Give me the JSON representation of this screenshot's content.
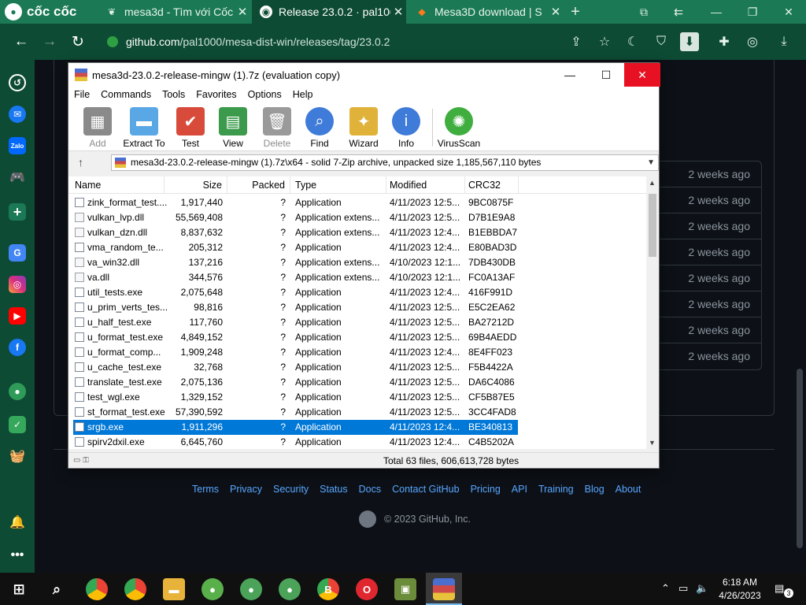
{
  "browser": {
    "brand": "cốc cốc",
    "tabs": [
      {
        "label": "mesa3d - Tìm với Cốc",
        "icon": "leaf-icon"
      },
      {
        "label": "Release 23.0.2 · pal100",
        "icon": "github-icon"
      },
      {
        "label": "Mesa3D download | S",
        "icon": "sourceforge-icon"
      }
    ],
    "new_tab": "+",
    "url_domain": "github.com",
    "url_path": "/pal1000/mesa-dist-win/releases/tag/23.0.2"
  },
  "page": {
    "release_times": [
      "2 weeks ago",
      "2 weeks ago",
      "2 weeks ago",
      "2 weeks ago",
      "2 weeks ago",
      "2 weeks ago",
      "2 weeks ago",
      "2 weeks ago"
    ],
    "footer_links": [
      "Terms",
      "Privacy",
      "Security",
      "Status",
      "Docs",
      "Contact GitHub",
      "Pricing",
      "API",
      "Training",
      "Blog",
      "About"
    ],
    "copyright": "© 2023 GitHub, Inc."
  },
  "rar": {
    "title": "mesa3d-23.0.2-release-mingw (1).7z (evaluation copy)",
    "menu": [
      "File",
      "Commands",
      "Tools",
      "Favorites",
      "Options",
      "Help"
    ],
    "tools": [
      {
        "label": "Add",
        "disabled": true
      },
      {
        "label": "Extract To",
        "disabled": false
      },
      {
        "label": "Test",
        "disabled": false
      },
      {
        "label": "View",
        "disabled": false
      },
      {
        "label": "Delete",
        "disabled": true
      },
      {
        "label": "Find",
        "disabled": false
      },
      {
        "label": "Wizard",
        "disabled": false
      },
      {
        "label": "Info",
        "disabled": false
      },
      {
        "label": "VirusScan",
        "disabled": false
      }
    ],
    "path": "mesa3d-23.0.2-release-mingw (1).7z\\x64 - solid 7-Zip archive, unpacked size 1,185,567,110 bytes",
    "columns": [
      "Name",
      "Size",
      "Packed",
      "Type",
      "Modified",
      "CRC32"
    ],
    "rows": [
      {
        "name": "zink_format_test....",
        "size": "1,917,440",
        "packed": "?",
        "type": "Application",
        "modified": "4/11/2023 12:5...",
        "crc": "9BC0875F",
        "dll": false
      },
      {
        "name": "vulkan_lvp.dll",
        "size": "55,569,408",
        "packed": "?",
        "type": "Application extens...",
        "modified": "4/11/2023 12:5...",
        "crc": "D7B1E9A8",
        "dll": true
      },
      {
        "name": "vulkan_dzn.dll",
        "size": "8,837,632",
        "packed": "?",
        "type": "Application extens...",
        "modified": "4/11/2023 12:4...",
        "crc": "B1EBBDA7",
        "dll": true
      },
      {
        "name": "vma_random_te...",
        "size": "205,312",
        "packed": "?",
        "type": "Application",
        "modified": "4/11/2023 12:4...",
        "crc": "E80BAD3D",
        "dll": false
      },
      {
        "name": "va_win32.dll",
        "size": "137,216",
        "packed": "?",
        "type": "Application extens...",
        "modified": "4/10/2023 12:1...",
        "crc": "7DB430DB",
        "dll": true
      },
      {
        "name": "va.dll",
        "size": "344,576",
        "packed": "?",
        "type": "Application extens...",
        "modified": "4/10/2023 12:1...",
        "crc": "FC0A13AF",
        "dll": true
      },
      {
        "name": "util_tests.exe",
        "size": "2,075,648",
        "packed": "?",
        "type": "Application",
        "modified": "4/11/2023 12:4...",
        "crc": "416F991D",
        "dll": false
      },
      {
        "name": "u_prim_verts_tes...",
        "size": "98,816",
        "packed": "?",
        "type": "Application",
        "modified": "4/11/2023 12:5...",
        "crc": "E5C2EA62",
        "dll": false
      },
      {
        "name": "u_half_test.exe",
        "size": "117,760",
        "packed": "?",
        "type": "Application",
        "modified": "4/11/2023 12:5...",
        "crc": "BA27212D",
        "dll": false
      },
      {
        "name": "u_format_test.exe",
        "size": "4,849,152",
        "packed": "?",
        "type": "Application",
        "modified": "4/11/2023 12:5...",
        "crc": "69B4AEDD",
        "dll": false
      },
      {
        "name": "u_format_comp...",
        "size": "1,909,248",
        "packed": "?",
        "type": "Application",
        "modified": "4/11/2023 12:4...",
        "crc": "8E4FF023",
        "dll": false
      },
      {
        "name": "u_cache_test.exe",
        "size": "32,768",
        "packed": "?",
        "type": "Application",
        "modified": "4/11/2023 12:5...",
        "crc": "F5B4422A",
        "dll": false
      },
      {
        "name": "translate_test.exe",
        "size": "2,075,136",
        "packed": "?",
        "type": "Application",
        "modified": "4/11/2023 12:5...",
        "crc": "DA6C4086",
        "dll": false
      },
      {
        "name": "test_wgl.exe",
        "size": "1,329,152",
        "packed": "?",
        "type": "Application",
        "modified": "4/11/2023 12:5...",
        "crc": "CF5B87E5",
        "dll": false
      },
      {
        "name": "st_format_test.exe",
        "size": "57,390,592",
        "packed": "?",
        "type": "Application",
        "modified": "4/11/2023 12:5...",
        "crc": "3CC4FAD8",
        "dll": false
      },
      {
        "name": "srgb.exe",
        "size": "1,911,296",
        "packed": "?",
        "type": "Application",
        "modified": "4/11/2023 12:4...",
        "crc": "BE340813",
        "dll": false,
        "selected": true
      },
      {
        "name": "spirv2dxil.exe",
        "size": "6,645,760",
        "packed": "?",
        "type": "Application",
        "modified": "4/11/2023 12:4...",
        "crc": "C4B5202A",
        "dll": false
      }
    ],
    "status": "Total 63 files, 606,613,728 bytes"
  },
  "taskbar": {
    "time": "6:18 AM",
    "date": "4/26/2023",
    "notifications": "3"
  },
  "colors": {
    "browser_green": "#1b7a55",
    "browser_dark": "#0d4b34",
    "github_bg": "#0d1117",
    "link": "#58a6ff",
    "selection": "#0078d7"
  }
}
